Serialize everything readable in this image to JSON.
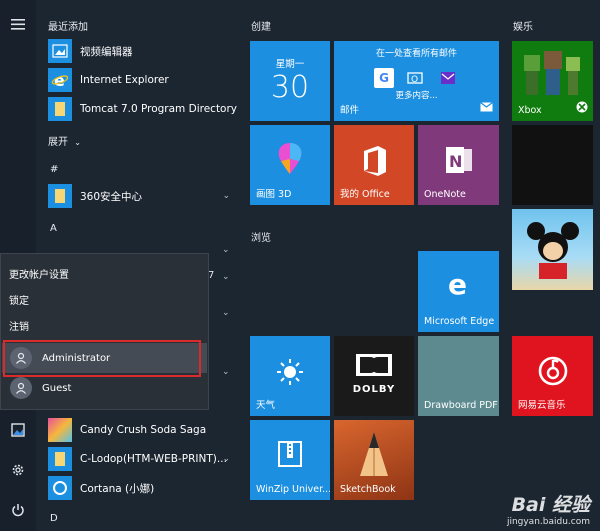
{
  "colors": {
    "tile_blue": "#1c8fe0",
    "office_red": "#d24726",
    "onenote_purple": "#80397b",
    "dark_tile": "#1a1a1a",
    "netease_red": "#e0141e",
    "drawboard": "#5c8a8f",
    "sketch": "#b24a27",
    "xbox_green": "#107c10"
  },
  "sidebar": {
    "items": [
      {
        "icon": "hamburger-icon"
      },
      {
        "icon": "image-icon"
      },
      {
        "icon": "settings-icon"
      },
      {
        "icon": "power-icon"
      }
    ]
  },
  "applist": {
    "recent_header": "最近添加",
    "recent_apps": [
      {
        "label": "视频编辑器",
        "icon": "video-editor-icon"
      },
      {
        "label": "Internet Explorer",
        "icon": "ie-icon"
      },
      {
        "label": "Tomcat 7.0 Program Directory",
        "icon": "folder-icon"
      }
    ],
    "expand_label": "展开",
    "letter_hash": "#",
    "app_360": "360安全中心",
    "letter_a": "A",
    "partial_label": "7",
    "apps_c": [
      {
        "label": "Candy Crush Soda Saga",
        "icon": "candy-crush-icon"
      },
      {
        "label": "C-Lodop(HTM-WEB-PRINT)...",
        "icon": "folder-icon"
      },
      {
        "label": "Cortana (小娜)",
        "icon": "cortana-icon"
      }
    ],
    "letter_d": "D"
  },
  "popup": {
    "items": [
      "更改帐户设置",
      "锁定",
      "注销"
    ],
    "users": [
      "Administrator",
      "Guest"
    ]
  },
  "groups": {
    "create": "创建",
    "browse": "浏览",
    "entertainment": "娱乐"
  },
  "tiles": {
    "calendar": {
      "weekday": "星期一",
      "day": "30"
    },
    "mail": {
      "top": "在一处查看所有邮件",
      "more": "更多内容...",
      "label": "邮件"
    },
    "paint3d": "画图 3D",
    "office": "我的 Office",
    "onenote": "OneNote",
    "edge": "Microsoft Edge",
    "weather": "天气",
    "dolby": "DOLBY",
    "drawboard": "Drawboard PDF",
    "netease": "网易云音乐",
    "winzip": "WinZip Univer...",
    "sketchbook": "SketchBook",
    "xbox": "Xbox"
  },
  "watermark": {
    "brand": "Bai 经验",
    "url": "jingyan.baidu.com"
  }
}
